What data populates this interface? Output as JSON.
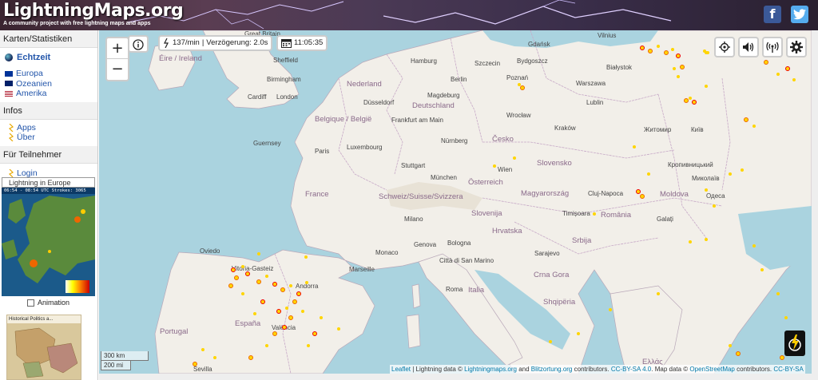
{
  "header": {
    "logo": "LightningMaps.org",
    "tagline": "A community project with free lightning maps and apps",
    "facebook_label": "f",
    "twitter_label": "t"
  },
  "sidebar": {
    "section_maps": "Karten/Statistiken",
    "realtime": "Echtzeit",
    "regions": [
      {
        "label": "Europa"
      },
      {
        "label": "Ozeanien"
      },
      {
        "label": "Amerika"
      }
    ],
    "section_info": "Infos",
    "info_items": [
      {
        "label": "Apps"
      },
      {
        "label": "Über"
      }
    ],
    "section_members": "Für Teilnehmer",
    "login": "Login",
    "minimap_select": "Lightning in Europe",
    "minimap_header": "06:54 - 08:54 UTC Strokes: 3065",
    "animation_label": "Animation",
    "ad_title": "Historical Politics a..."
  },
  "map": {
    "zoom_in": "+",
    "zoom_out": "−",
    "status_rate": "137/min",
    "status_delay": "Verzögerung: 2.0s",
    "clock_time": "11:05:35",
    "scale_km": "300 km",
    "scale_mi": "200 mi",
    "attribution": {
      "leaflet": "Leaflet",
      "lightning_prefix": " | Lightning data © ",
      "lightningmaps": "Lightningmaps.org",
      "and": " and ",
      "blitzortung": "Blitzortung.org",
      "contributors": " contributors. ",
      "ccbysa40": "CC-BY-SA 4.0",
      "mapdata": ". Map data © ",
      "osm": "OpenStreetMap",
      "contributors2": " contributors. ",
      "ccbysa": "CC-BY-SA"
    },
    "labels": [
      {
        "text": "Great Britain"
      },
      {
        "text": "Éire / Ireland"
      },
      {
        "text": "Sheffield"
      },
      {
        "text": "Birmingham"
      },
      {
        "text": "Cardiff"
      },
      {
        "text": "London"
      },
      {
        "text": "Hamburg"
      },
      {
        "text": "Szczecin"
      },
      {
        "text": "Bydgoszcz"
      },
      {
        "text": "Gdańsk"
      },
      {
        "text": "Vilnius"
      },
      {
        "text": "Nederland"
      },
      {
        "text": "Berlin"
      },
      {
        "text": "Poznań"
      },
      {
        "text": "Warszawa"
      },
      {
        "text": "Białystok"
      },
      {
        "text": "Düsseldorf"
      },
      {
        "text": "Magdeburg"
      },
      {
        "text": "Deutschland"
      },
      {
        "text": "Belgique / België"
      },
      {
        "text": "Frankfurt am Main"
      },
      {
        "text": "Wrocław"
      },
      {
        "text": "Kraków"
      },
      {
        "text": "Lublin"
      },
      {
        "text": "Luxembourg"
      },
      {
        "text": "Paris"
      },
      {
        "text": "Nürnberg"
      },
      {
        "text": "Česko"
      },
      {
        "text": "Guernsey"
      },
      {
        "text": "Stuttgart"
      },
      {
        "text": "München"
      },
      {
        "text": "Wien"
      },
      {
        "text": "Slovensko"
      },
      {
        "text": "France"
      },
      {
        "text": "Schweiz/Suisse/Svizzera"
      },
      {
        "text": "Österreich"
      },
      {
        "text": "Magyarország"
      },
      {
        "text": "Cluj-Napoca"
      },
      {
        "text": "Moldova"
      },
      {
        "text": "Milano"
      },
      {
        "text": "Slovenija"
      },
      {
        "text": "Timișoara"
      },
      {
        "text": "România"
      },
      {
        "text": "Genova"
      },
      {
        "text": "Bologna"
      },
      {
        "text": "Hrvatska"
      },
      {
        "text": "Srbija"
      },
      {
        "text": "Monaco"
      },
      {
        "text": "Marseille"
      },
      {
        "text": "Città di San Marino"
      },
      {
        "text": "Sarajevo"
      },
      {
        "text": "Andorra"
      },
      {
        "text": "Italia"
      },
      {
        "text": "Roma"
      },
      {
        "text": "Crna Gora"
      },
      {
        "text": "Shqipëria"
      },
      {
        "text": "Vitoria-Gasteiz"
      },
      {
        "text": "Oviedo"
      },
      {
        "text": "España"
      },
      {
        "text": "Portugal"
      },
      {
        "text": "València"
      },
      {
        "text": "Sevilla"
      },
      {
        "text": "Ελλάς"
      },
      {
        "text": "Київ"
      },
      {
        "text": "Житомир"
      },
      {
        "text": "Кропивницький"
      },
      {
        "text": "Миколаїв"
      },
      {
        "text": "Одеса"
      },
      {
        "text": "Galați"
      }
    ]
  }
}
